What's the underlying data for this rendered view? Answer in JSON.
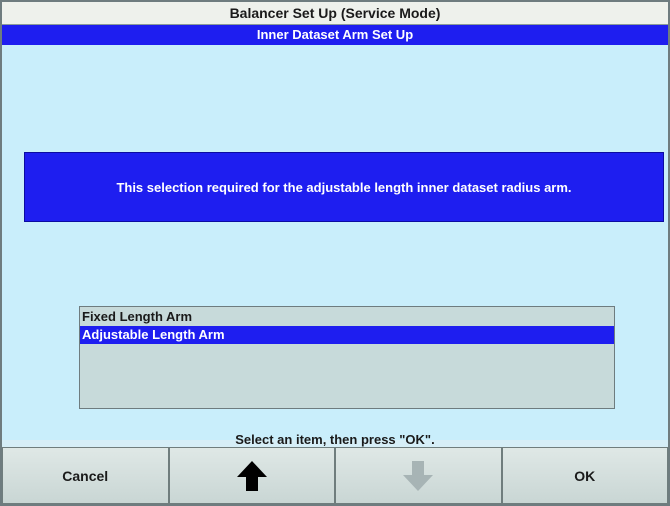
{
  "window": {
    "title": "Balancer Set Up (Service Mode)",
    "subtitle": "Inner Dataset Arm Set Up"
  },
  "message": "This selection required for the adjustable length inner dataset radius arm.",
  "list": {
    "items": [
      {
        "label": "Fixed Length Arm",
        "selected": false
      },
      {
        "label": "Adjustable Length Arm",
        "selected": true
      }
    ]
  },
  "prompt": "Select an item, then press \"OK\".",
  "buttons": {
    "cancel": "Cancel",
    "up": "up-arrow-icon",
    "down": "down-arrow-icon",
    "ok": "OK"
  },
  "colors": {
    "accent_blue": "#1e1ef0",
    "background": "#c9eefb"
  }
}
